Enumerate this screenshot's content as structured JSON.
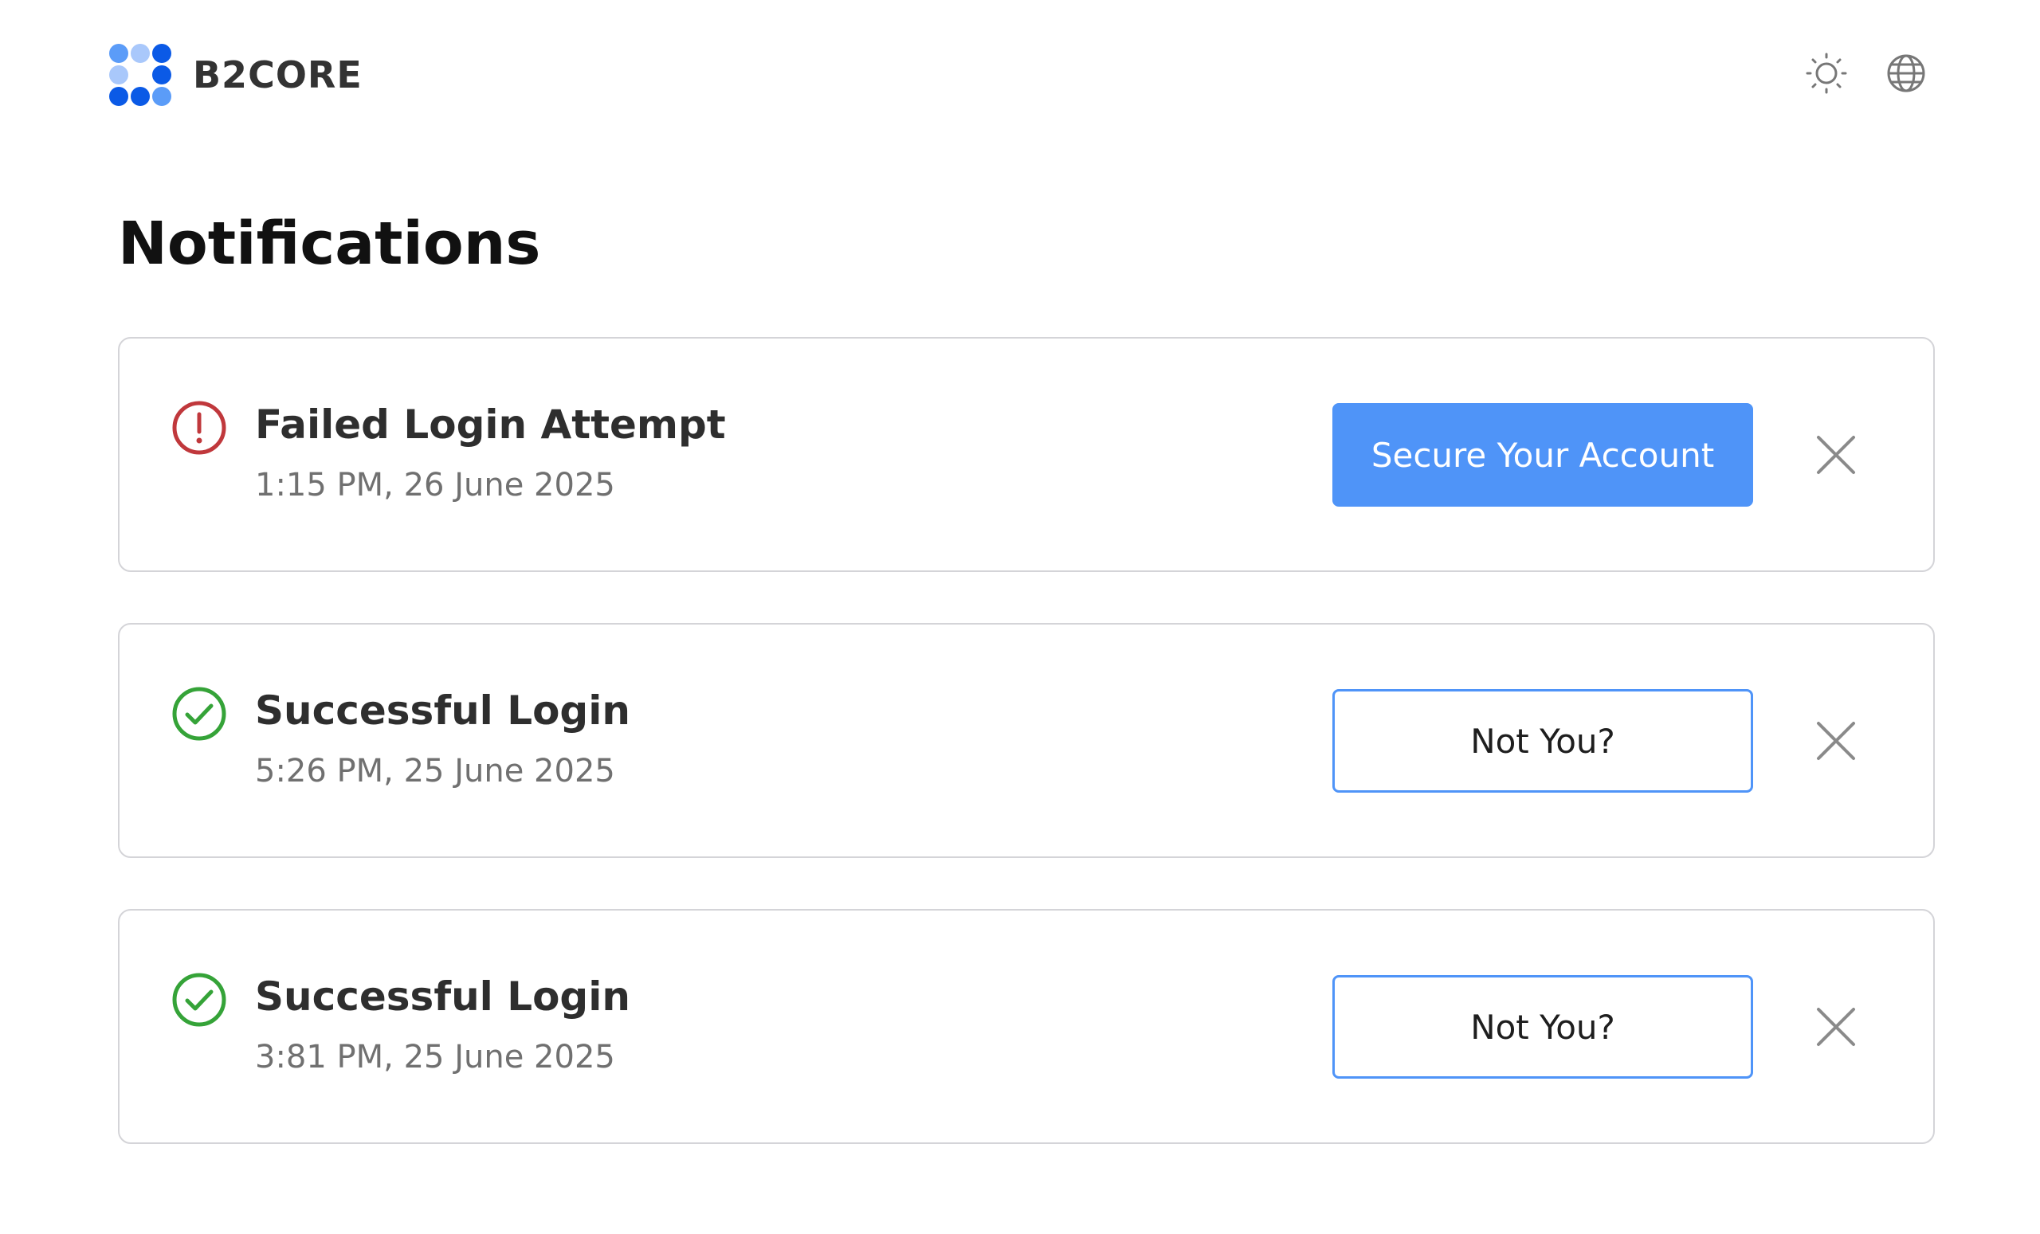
{
  "app": {
    "brand": "B2CORE",
    "logo_colors": [
      "#5b9cf8",
      "#a9c8fb",
      "#0b5ae6"
    ]
  },
  "header": {
    "theme_icon": "sun-icon",
    "language_icon": "globe-icon"
  },
  "page": {
    "title": "Notifications"
  },
  "notifications": [
    {
      "status": "error",
      "status_icon": "alert-circle-icon",
      "title": "Failed Login Attempt",
      "time": "1:15 PM, 26 June 2025",
      "action_label": "Secure Your Account",
      "action_style": "primary",
      "close_icon": "close-icon"
    },
    {
      "status": "success",
      "status_icon": "check-circle-icon",
      "title": "Successful Login",
      "time": "5:26 PM, 25 June 2025",
      "action_label": "Not You?",
      "action_style": "outline",
      "close_icon": "close-icon"
    },
    {
      "status": "success",
      "status_icon": "check-circle-icon",
      "title": "Successful Login",
      "time": "3:81 PM, 25 June 2025",
      "action_label": "Not You?",
      "action_style": "outline",
      "close_icon": "close-icon"
    }
  ],
  "colors": {
    "accent": "#4f94f8",
    "error": "#c0383c",
    "success": "#35a338",
    "border": "#d4d4d8",
    "muted_text": "#707070",
    "icon_gray": "#777777"
  }
}
